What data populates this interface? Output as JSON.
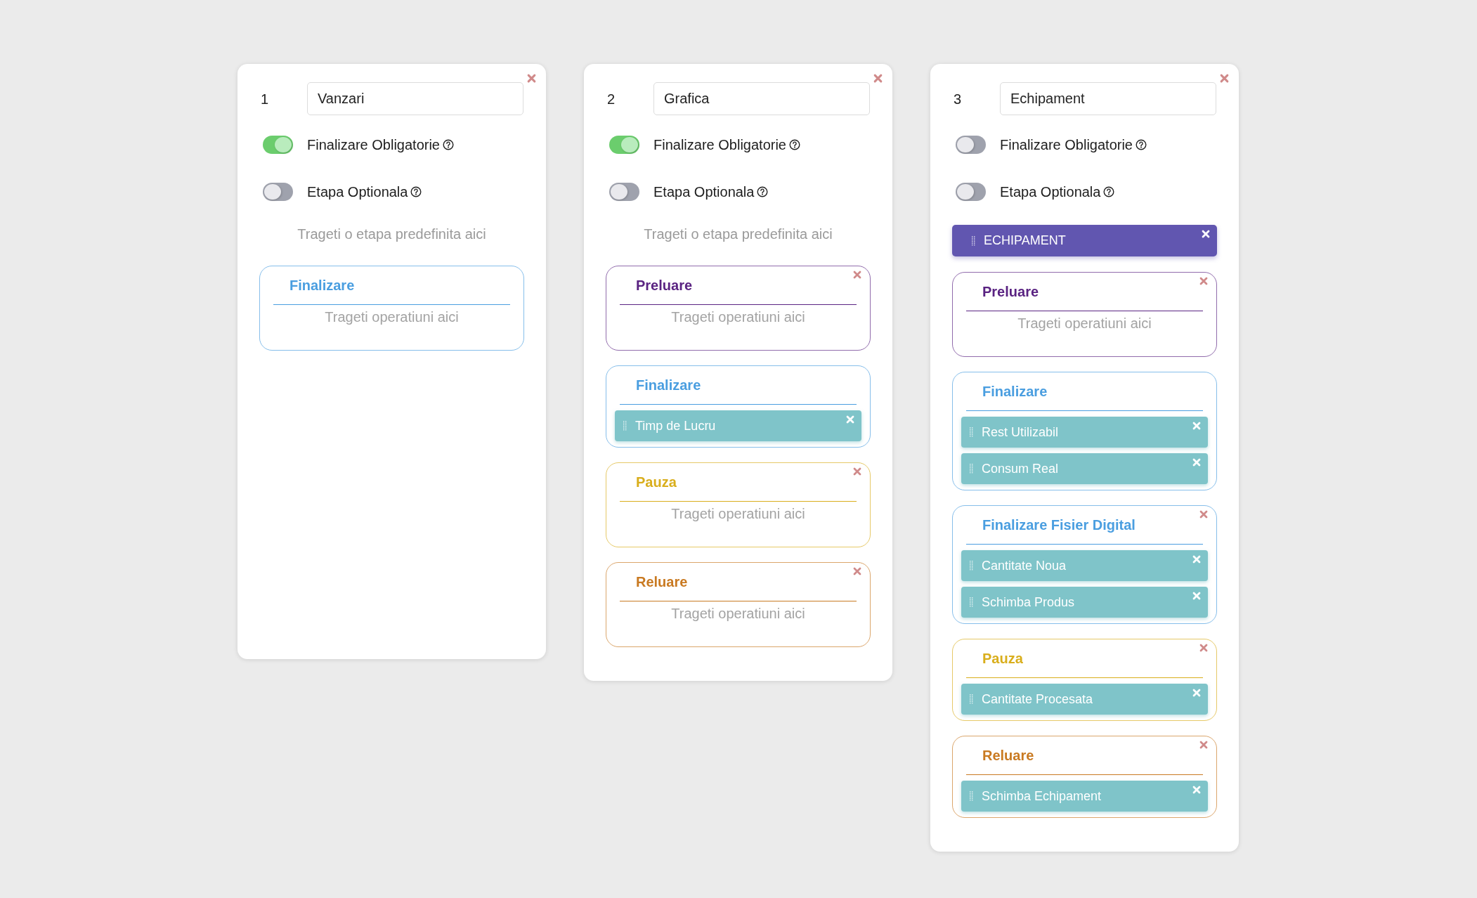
{
  "columns": [
    {
      "number": "1",
      "name": "Vanzari",
      "toggles": [
        {
          "label": "Finalizare Obligatorie",
          "on": true
        },
        {
          "label": "Etapa Optionala",
          "on": false
        }
      ],
      "drop_hint": "Trageti o etapa predefinita aici",
      "stages": [
        {
          "title": "Finalizare",
          "color": "#4a9ee0",
          "removable": false,
          "hint": "Trageti operatiuni aici"
        }
      ]
    },
    {
      "number": "2",
      "name": "Grafica",
      "toggles": [
        {
          "label": "Finalizare Obligatorie",
          "on": true
        },
        {
          "label": "Etapa Optionala",
          "on": false
        }
      ],
      "drop_hint": "Trageti o etapa predefinita aici",
      "stages": [
        {
          "title": "Preluare",
          "color": "#5a2382",
          "removable": true,
          "hint": "Trageti operatiuni aici"
        },
        {
          "title": "Finalizare",
          "color": "#4a9ee0",
          "removable": false,
          "operations": [
            "Timp de Lucru"
          ]
        },
        {
          "title": "Pauza",
          "color": "#d9ae1c",
          "removable": true,
          "hint": "Trageti operatiuni aici"
        },
        {
          "title": "Reluare",
          "color": "#c97a22",
          "removable": true,
          "hint": "Trageti operatiuni aici"
        }
      ]
    },
    {
      "number": "3",
      "name": "Echipament",
      "toggles": [
        {
          "label": "Finalizare Obligatorie",
          "on": false
        },
        {
          "label": "Etapa Optionala",
          "on": false
        }
      ],
      "preset": "ECHIPAMENT",
      "stages": [
        {
          "title": "Preluare",
          "color": "#5a2382",
          "removable": true,
          "hint": "Trageti operatiuni aici"
        },
        {
          "title": "Finalizare",
          "color": "#4a9ee0",
          "removable": false,
          "operations": [
            "Rest Utilizabil",
            "Consum Real"
          ]
        },
        {
          "title": "Finalizare Fisier Digital",
          "color": "#4a9ee0",
          "removable": true,
          "operations": [
            "Cantitate Noua",
            "Schimba Produs"
          ]
        },
        {
          "title": "Pauza",
          "color": "#d9ae1c",
          "removable": true,
          "operations": [
            "Cantitate Procesata"
          ]
        },
        {
          "title": "Reluare",
          "color": "#c97a22",
          "removable": true,
          "operations": [
            "Schimba Echipament"
          ]
        }
      ]
    }
  ]
}
